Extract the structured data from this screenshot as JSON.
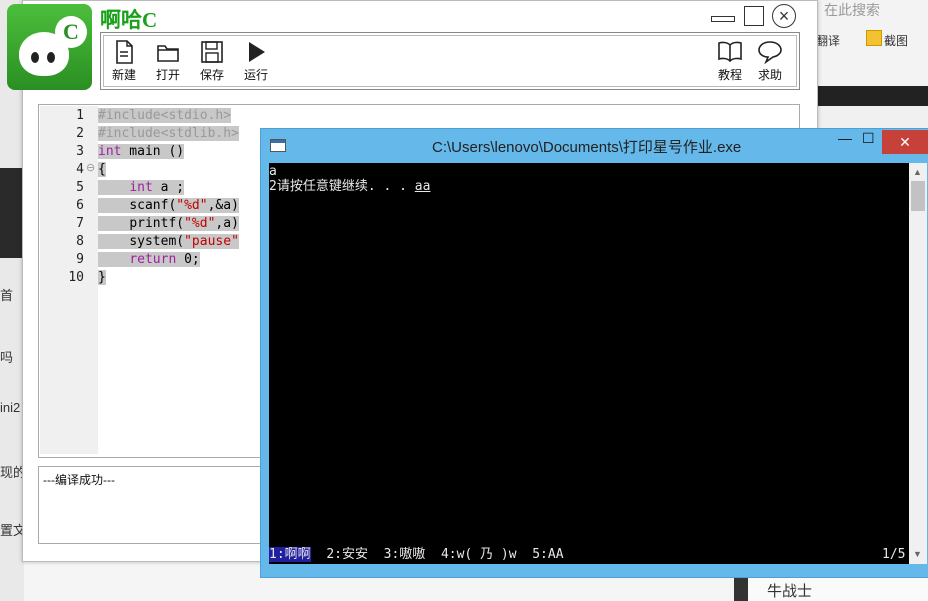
{
  "background": {
    "left_fragments": [
      "吗",
      "ini2",
      "现的",
      "置文"
    ],
    "left_tab": "首",
    "search_hint": "在此搜索",
    "translate_label": "翻译",
    "screenshot_label": "截图",
    "bottom_name": "牛战士"
  },
  "app": {
    "title": "啊哈C",
    "logo_letter": "C",
    "toolbar": {
      "new": "新建",
      "open": "打开",
      "save": "保存",
      "run": "运行",
      "tutorial": "教程",
      "help": "求助"
    },
    "line_numbers": [
      "1",
      "2",
      "3",
      "4",
      "5",
      "6",
      "7",
      "8",
      "9",
      "10"
    ],
    "code": {
      "l1": "#include<stdio.h>",
      "l2": "#include<stdlib.h>",
      "l3_kw": "int",
      "l3_rest": " main ()",
      "l4": "{",
      "l5_kw": "int",
      "l5_rest": " a ;",
      "l6_a": "scanf(",
      "l6_str": "\"%d\"",
      "l6_b": ",&a)",
      "l7_a": "printf(",
      "l7_str": "\"%d\"",
      "l7_b": ",a)",
      "l8_a": "system(",
      "l8_str": "\"pause\"",
      "l9_kw": "return",
      "l9_rest": " 0;",
      "l10": "}"
    },
    "output_text": "---编译成功---"
  },
  "console": {
    "title": "C:\\Users\\lenovo\\Documents\\打印星号作业.exe",
    "min": "—",
    "max": "☐",
    "close": "✕",
    "line1": "a",
    "line2_prefix": "2请按任意键继续. . . ",
    "line2_input": "aa",
    "ime_candidates": {
      "c1": "1:啊啊",
      "c2": "2:安安",
      "c3": "3:嗷嗷",
      "c4": "4:w( 乃 )w",
      "c5": "5:AA"
    },
    "ime_page": "1/5"
  },
  "colors": {
    "title_green": "#1aa11a",
    "console_frame": "#64b8ea",
    "close_red": "#c7413b",
    "keyword_purple": "#a020a0",
    "string_red": "#c00000"
  }
}
